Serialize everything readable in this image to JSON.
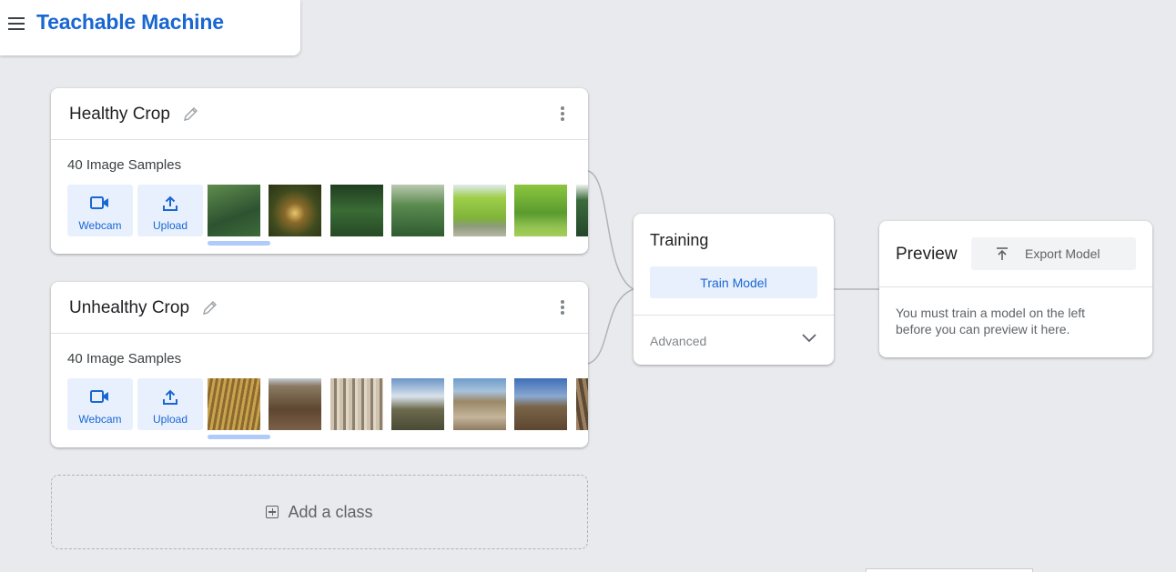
{
  "app": {
    "title": "Teachable Machine"
  },
  "classes": [
    {
      "name": "Healthy Crop",
      "samples_label": "40 Image Samples",
      "webcam_label": "Webcam",
      "upload_label": "Upload",
      "thumb_colors": [
        "#3d6b3a",
        "#5a4a22",
        "#2e4d2c",
        "#4e7a45",
        "#8fba3e",
        "#6ea83a",
        "#2f5a34"
      ]
    },
    {
      "name": "Unhealthy Crop",
      "samples_label": "40 Image Samples",
      "webcam_label": "Webcam",
      "upload_label": "Upload",
      "thumb_colors": [
        "#b8913f",
        "#6b5238",
        "#a89a86",
        "#6a6b52",
        "#9c8c72",
        "#6e5a3c",
        "#7a6850"
      ]
    }
  ],
  "add_class": {
    "label": "Add a class"
  },
  "training": {
    "title": "Training",
    "train_button": "Train Model",
    "advanced_label": "Advanced"
  },
  "preview": {
    "title": "Preview",
    "export_button": "Export Model",
    "message": "You must train a model on the left before you can preview it here."
  },
  "colors": {
    "accent": "#1967d2",
    "button_bg": "#e8f0fe",
    "canvas_bg": "#e8eaed"
  }
}
